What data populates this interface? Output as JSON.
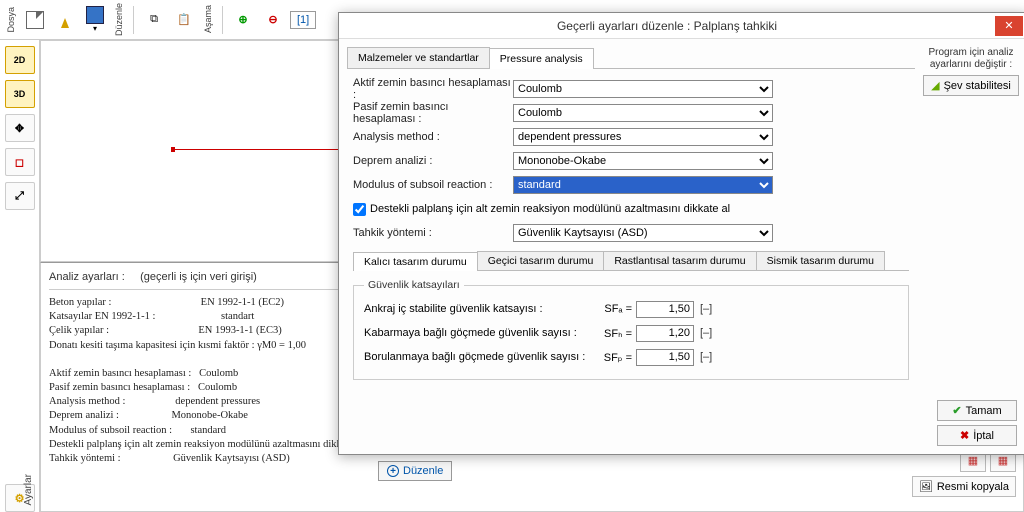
{
  "topbar": {
    "labels": {
      "dosya": "Dosya",
      "duzenle": "Düzenle",
      "asama": "Aşama"
    },
    "tab1": "[1]"
  },
  "leftbar": {
    "btn2d": "2D",
    "btn3d": "3D"
  },
  "infopanel": {
    "header_label": "Analiz ayarları :",
    "header_value": "(geçerli iş için veri girişi)",
    "text": "Beton yapılar :                                  EN 1992-1-1 (EC2)\nKatsayılar EN 1992-1-1 :                         standart\nÇelik yapılar :                                  EN 1993-1-1 (EC3)\nDonatı kesiti taşıma kapasitesi için kısmi faktör : γM0 = 1,00\n\nAktif zemin basıncı hesaplaması :   Coulomb\nPasif zemin basıncı hesaplaması :   Coulomb\nAnalysis method :                   dependent pressures\nDeprem analizi :                    Mononobe-Okabe\nModulus of subsoil reaction :       standard\nDestekli palplanş için alt zemin reaksiyon modülünü azaltmasını dikkate al\nTahkik yöntemi :                    Güvenlik Kaytsayısı (ASD)",
    "side": "Ayarlar",
    "editbtn": "Düzenle"
  },
  "rb": {
    "copy": "Resmi kopyala"
  },
  "dialog": {
    "title": "Geçerli ayarları düzenle : Palplanş tahkiki",
    "tabs": {
      "materials": "Malzemeler ve standartlar",
      "pressure": "Pressure analysis"
    },
    "form": {
      "active_label": "Aktif zemin basıncı hesaplaması :",
      "active_value": "Coulomb",
      "passive_label": "Pasif zemin basıncı hesaplaması :",
      "passive_value": "Coulomb",
      "method_label": "Analysis method :",
      "method_value": "dependent pressures",
      "quake_label": "Deprem analizi :",
      "quake_value": "Mononobe-Okabe",
      "modulus_label": "Modulus of subsoil reaction :",
      "modulus_value": "standard",
      "check_label": "Destekli palplanş için alt zemin reaksiyon modülünü azaltmasını dikkate al",
      "verify_label": "Tahkik yöntemi :",
      "verify_value": "Güvenlik Kaytsayısı (ASD)"
    },
    "subtabs": {
      "t1": "Kalıcı tasarım durumu",
      "t2": "Geçici tasarım durumu",
      "t3": "Rastlantısal tasarım durumu",
      "t4": "Sismik tasarım durumu"
    },
    "fs_legend": "Güvenlik katsayıları",
    "rows": {
      "r1_label": "Ankraj iç stabilite güvenlik katsayısı :",
      "r1_sym": "SFₐ =",
      "r1_val": "1,50",
      "r2_label": "Kabarmaya bağlı göçmede güvenlik sayısı :",
      "r2_sym": "SFₕ =",
      "r2_val": "1,20",
      "r3_label": "Borulanmaya bağlı göçmede güvenlik sayısı :",
      "r3_sym": "SFₚ =",
      "r3_val": "1,50",
      "unit": "[–]"
    },
    "right": {
      "hint": "Program için analiz ayarlarını değiştir :",
      "slope": "Şev stabilitesi"
    },
    "foot": {
      "ok": "Tamam",
      "cancel": "İptal"
    }
  }
}
